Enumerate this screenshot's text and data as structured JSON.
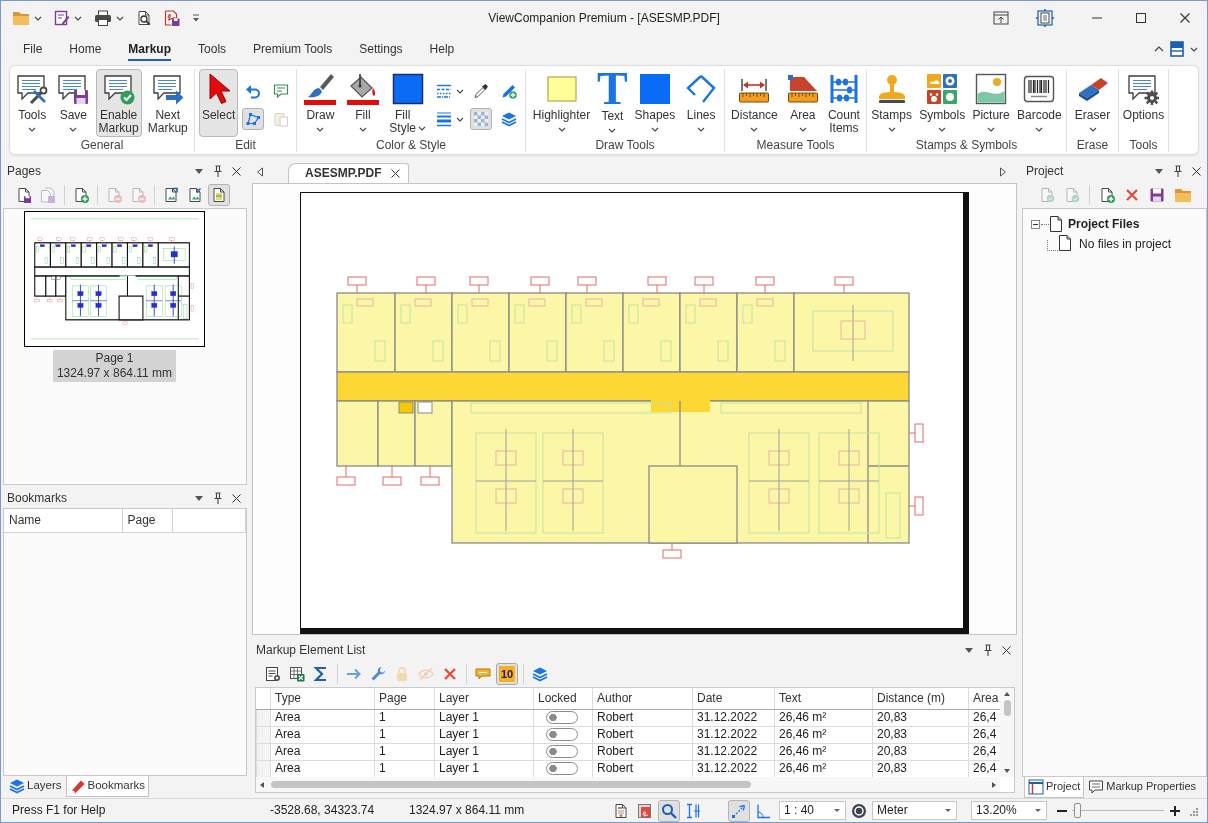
{
  "window": {
    "title": "ViewCompanion Premium - [ASESMP.PDF]"
  },
  "quick_access": [
    {
      "dropdown": true
    },
    {
      "dropdown": true
    },
    {
      "dropdown": true
    },
    {
      "dropdown": false
    },
    {
      "dropdown": false
    }
  ],
  "menu_tabs": [
    {
      "label": "File",
      "selected": false
    },
    {
      "label": "Home",
      "selected": false
    },
    {
      "label": "Markup",
      "selected": true
    },
    {
      "label": "Tools",
      "selected": false
    },
    {
      "label": "Premium Tools",
      "selected": false
    },
    {
      "label": "Settings",
      "selected": false
    },
    {
      "label": "Help",
      "selected": false
    }
  ],
  "ribbon": {
    "groups": [
      {
        "label": "General",
        "buttons": [
          {
            "label": "Tools",
            "dropdown": true,
            "active": false
          },
          {
            "label": "Save",
            "dropdown": true,
            "active": false
          },
          {
            "label": "Enable Markup",
            "dropdown": false,
            "active": true
          },
          {
            "label": "Next Markup",
            "dropdown": false,
            "active": false
          }
        ]
      },
      {
        "label": "Edit",
        "buttons": [
          {
            "label": "Select",
            "dropdown": false,
            "active": true
          }
        ],
        "small_buttons": [
          {
            "active": false,
            "disabled": false,
            "dropdown": false
          },
          {
            "active": false,
            "disabled": false,
            "dropdown": false
          },
          {
            "active": true,
            "disabled": false,
            "dropdown": false
          },
          {
            "active": false,
            "disabled": true,
            "dropdown": false
          }
        ]
      },
      {
        "label": "Color & Style",
        "buttons": [
          {
            "label": "Draw",
            "dropdown": true,
            "active": false
          },
          {
            "label": "Fill",
            "dropdown": true,
            "active": false
          },
          {
            "label": "Fill Style",
            "dropdown": true,
            "caret_beside": true,
            "active": false
          }
        ],
        "small_buttons": [
          {
            "active": false,
            "disabled": false,
            "dropdown": true
          },
          {
            "active": false,
            "disabled": false,
            "dropdown": false
          },
          {
            "active": false,
            "disabled": false,
            "dropdown": false
          },
          {
            "active": false,
            "disabled": false,
            "dropdown": true
          },
          {
            "active": true,
            "disabled": false,
            "dropdown": false
          },
          {
            "active": false,
            "disabled": false,
            "dropdown": false
          }
        ]
      },
      {
        "label": "Draw Tools",
        "buttons": [
          {
            "label": "Highlighter",
            "dropdown": true,
            "active": false
          },
          {
            "label": "Text",
            "glyph": "T",
            "dropdown": true,
            "active": false
          },
          {
            "label": "Shapes",
            "dropdown": true,
            "active": false
          },
          {
            "label": "Lines",
            "dropdown": true,
            "active": false
          }
        ]
      },
      {
        "label": "Measure Tools",
        "buttons": [
          {
            "label": "Distance",
            "dropdown": true,
            "active": false
          },
          {
            "label": "Area",
            "dropdown": true,
            "active": false
          },
          {
            "label": "Count Items",
            "dropdown": false,
            "active": false
          }
        ]
      },
      {
        "label": "Stamps & Symbols",
        "buttons": [
          {
            "label": "Stamps",
            "dropdown": true,
            "active": false
          },
          {
            "label": "Symbols",
            "dropdown": true,
            "active": false
          },
          {
            "label": "Picture",
            "dropdown": true,
            "active": false
          },
          {
            "label": "Barcode",
            "dropdown": true,
            "active": false
          }
        ]
      },
      {
        "label": "Erase",
        "buttons": [
          {
            "label": "Eraser",
            "dropdown": true,
            "active": false
          }
        ]
      },
      {
        "label": "Tools",
        "buttons": [
          {
            "label": "Options",
            "dropdown": false,
            "active": false
          }
        ]
      }
    ]
  },
  "pages_panel": {
    "title": "Pages",
    "toolbar": [
      {
        "active": false,
        "disabled": false
      },
      {
        "active": false,
        "disabled": true
      },
      {
        "active": false,
        "disabled": false
      },
      {
        "active": false,
        "disabled": true
      },
      {
        "active": false,
        "disabled": true
      },
      {
        "active": false,
        "disabled": false
      },
      {
        "active": false,
        "disabled": false
      },
      {
        "active": true,
        "disabled": false
      }
    ],
    "pages": [
      {
        "label": "Page 1",
        "size": "1324.97 x 864.11 mm",
        "selected": true
      }
    ]
  },
  "bookmarks_panel": {
    "title": "Bookmarks",
    "columns": [
      "Name",
      "Page"
    ]
  },
  "left_tabs": [
    {
      "label": "Layers",
      "selected": false
    },
    {
      "label": "Bookmarks",
      "selected": true
    }
  ],
  "document_tabs": [
    {
      "label": "ASESMP.PDF",
      "selected": true
    }
  ],
  "markup_list": {
    "title": "Markup Element List",
    "toolbar": [
      {
        "kind": "icon",
        "active": false,
        "disabled": false
      },
      {
        "kind": "icon",
        "active": false,
        "disabled": false
      },
      {
        "kind": "icon",
        "active": false,
        "disabled": false
      },
      {
        "kind": "icon",
        "active": false,
        "disabled": false
      },
      {
        "kind": "icon",
        "active": false,
        "disabled": false
      },
      {
        "kind": "icon",
        "active": false,
        "disabled": true
      },
      {
        "kind": "icon",
        "active": false,
        "disabled": true
      },
      {
        "kind": "icon",
        "active": false,
        "disabled": false
      },
      {
        "kind": "icon",
        "active": false,
        "disabled": false
      },
      {
        "kind": "count",
        "label": "10",
        "active": true
      },
      {
        "kind": "icon",
        "active": false,
        "disabled": false
      }
    ],
    "columns": [
      "Type",
      "Page",
      "Layer",
      "Locked",
      "Author",
      "Date",
      "Text",
      "Distance (m)",
      "Area"
    ],
    "rows": [
      {
        "type": "Area",
        "page": "1",
        "layer": "Layer 1",
        "locked": false,
        "author": "Robert",
        "date": "31.12.2022",
        "text": "26,46 m²",
        "distance": "20,83",
        "area": "26,4"
      },
      {
        "type": "Area",
        "page": "1",
        "layer": "Layer 1",
        "locked": false,
        "author": "Robert",
        "date": "31.12.2022",
        "text": "26,46 m²",
        "distance": "20,83",
        "area": "26,4"
      },
      {
        "type": "Area",
        "page": "1",
        "layer": "Layer 1",
        "locked": false,
        "author": "Robert",
        "date": "31.12.2022",
        "text": "26,46 m²",
        "distance": "20,83",
        "area": "26,4"
      },
      {
        "type": "Area",
        "page": "1",
        "layer": "Layer 1",
        "locked": false,
        "author": "Robert",
        "date": "31.12.2022",
        "text": "26,46 m²",
        "distance": "20,83",
        "area": "26,4"
      }
    ]
  },
  "project_panel": {
    "title": "Project",
    "toolbar": [
      {
        "active": false,
        "disabled": true
      },
      {
        "active": false,
        "disabled": true
      },
      {
        "active": false,
        "disabled": false
      },
      {
        "active": false,
        "disabled": false
      },
      {
        "active": false,
        "disabled": false
      },
      {
        "active": false,
        "disabled": false
      }
    ],
    "tree": [
      {
        "label": "Project Files",
        "expanded": true,
        "children": [
          {
            "label": "No files in project"
          }
        ]
      }
    ]
  },
  "right_tabs": [
    {
      "label": "Project",
      "selected": true
    },
    {
      "label": "Markup Properties",
      "selected": false
    }
  ],
  "status_bar": {
    "help": "Press F1 for Help",
    "coordinates": "-3528.68, 34323.74",
    "page_size": "1324.97 x 864.11 mm",
    "view_tools": [
      {
        "active": false
      },
      {
        "active": false
      },
      {
        "active": true
      },
      {
        "active": false
      }
    ],
    "snap_tools": [
      {
        "active": true
      },
      {
        "active": false
      }
    ],
    "scale": "1 : 40",
    "unit": "Meter",
    "zoom": "13.20%",
    "zoom_slider": {
      "level": 0.03
    }
  }
}
